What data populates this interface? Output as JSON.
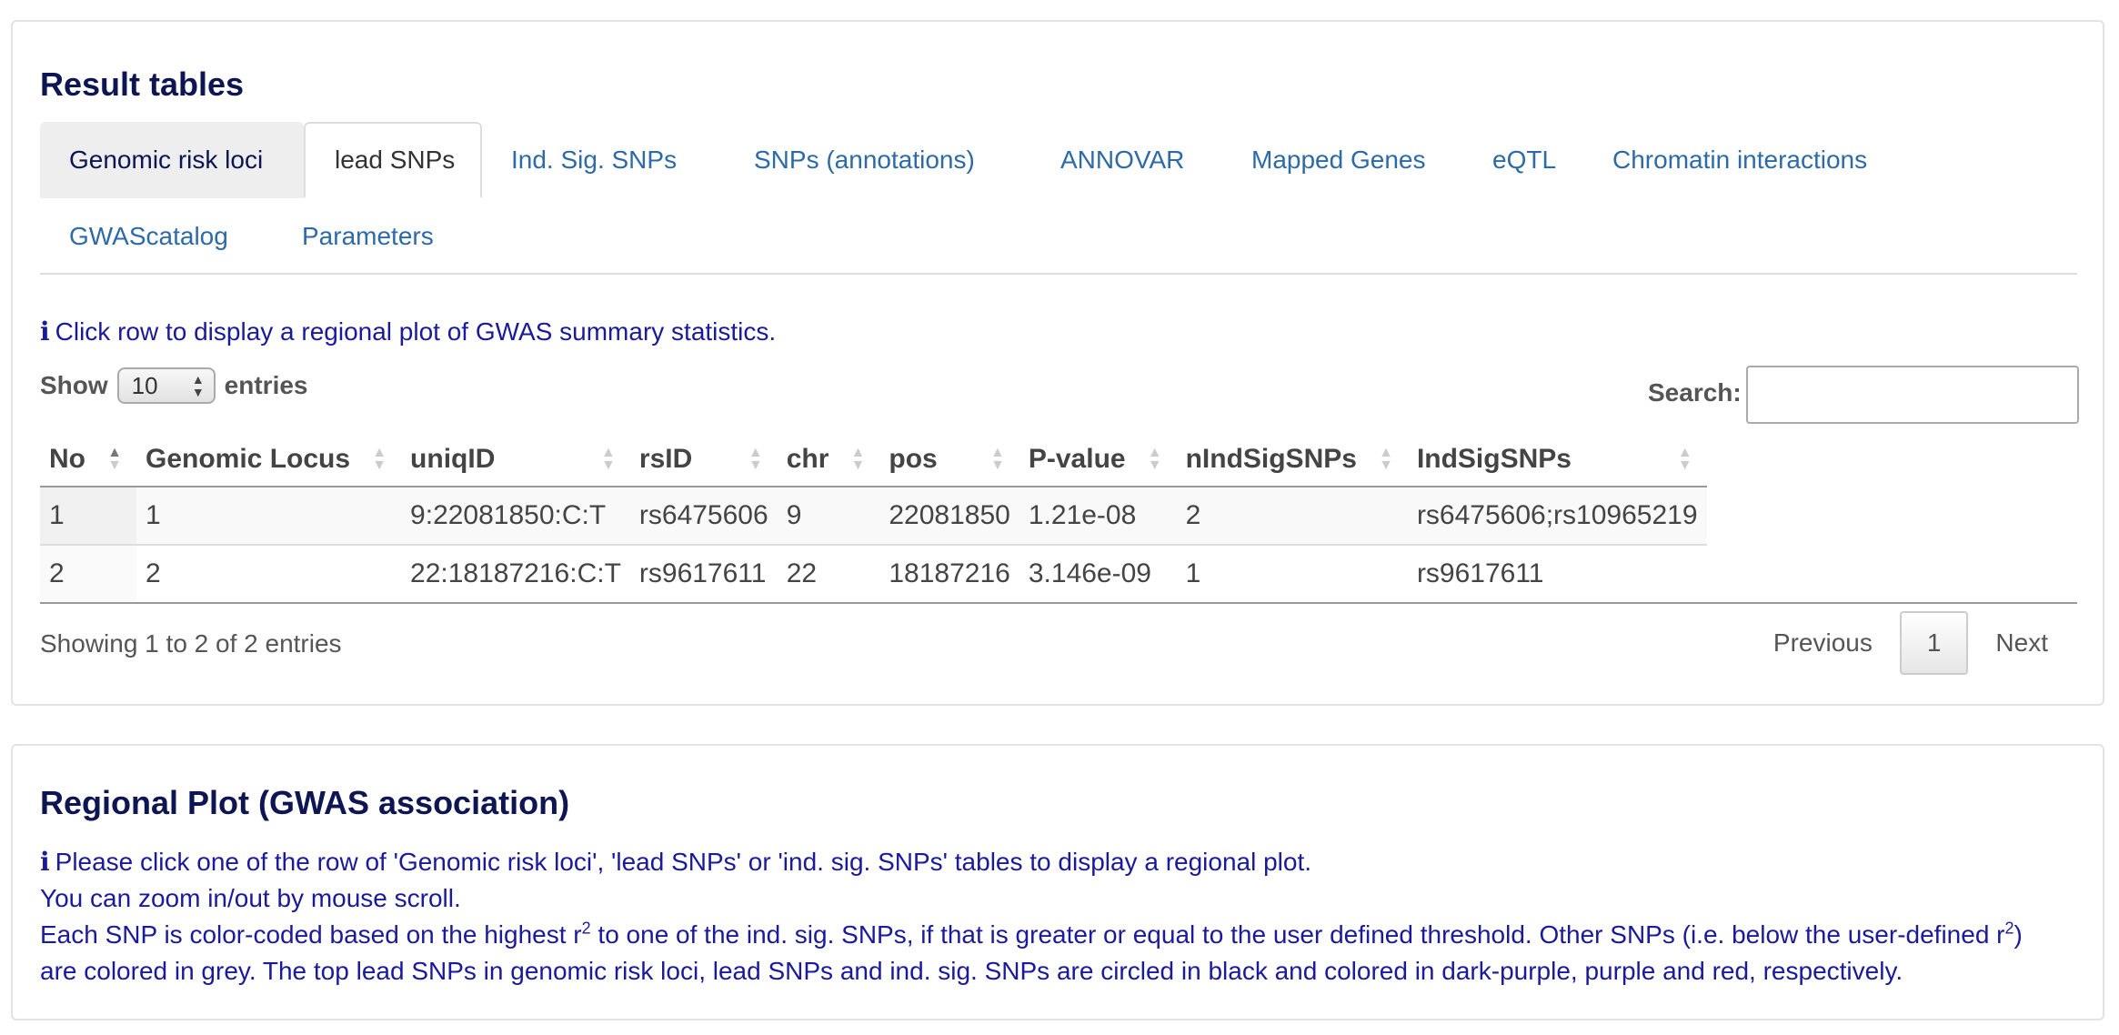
{
  "results": {
    "title": "Result tables",
    "tabs": [
      {
        "label": "Genomic risk loci",
        "state": "hover"
      },
      {
        "label": "lead SNPs",
        "state": "active"
      },
      {
        "label": "Ind. Sig. SNPs",
        "state": "normal"
      },
      {
        "label": "SNPs (annotations)",
        "state": "normal"
      },
      {
        "label": "ANNOVAR",
        "state": "normal"
      },
      {
        "label": "Mapped Genes",
        "state": "normal"
      },
      {
        "label": "eQTL",
        "state": "normal"
      },
      {
        "label": "Chromatin interactions",
        "state": "normal"
      },
      {
        "label": "GWAScatalog",
        "state": "normal"
      },
      {
        "label": "Parameters",
        "state": "normal"
      }
    ],
    "info_icon": "i",
    "info_text": "Click row to display a regional plot of GWAS summary statistics.",
    "show_label": "Show",
    "show_value": "10",
    "entries_label": "entries",
    "search_label": "Search:",
    "search_value": "",
    "columns": [
      "No",
      "Genomic Locus",
      "uniqID",
      "rsID",
      "chr",
      "pos",
      "P-value",
      "nIndSigSNPs",
      "IndSigSNPs"
    ],
    "sorted_column": "No",
    "rows": [
      [
        "1",
        "1",
        "9:22081850:C:T",
        "rs6475606",
        "9",
        "22081850",
        "1.21e-08",
        "2",
        "rs6475606;rs10965219"
      ],
      [
        "2",
        "2",
        "22:18187216:C:T",
        "rs9617611",
        "22",
        "18187216",
        "3.146e-09",
        "1",
        "rs9617611"
      ]
    ],
    "showing_text": "Showing 1 to 2 of 2 entries",
    "pagination": {
      "previous": "Previous",
      "page": "1",
      "next": "Next"
    }
  },
  "regional": {
    "title": "Regional Plot (GWAS association)",
    "info_icon": "i",
    "line1": "Please click one of the row of 'Genomic risk loci', 'lead SNPs' or 'ind. sig. SNPs' tables to display a regional plot.",
    "line2": "You can zoom in/out by mouse scroll.",
    "line3_a": "Each SNP is color-coded based on the highest r",
    "sup1": "2",
    "line3_b": " to one of the ind. sig. SNPs, if that is greater or equal to the user defined threshold. Other SNPs (i.e. below the user-defined r",
    "sup2": "2",
    "line3_c": ")",
    "line4": "are colored in grey. The top lead SNPs in genomic risk loci, lead SNPs and ind. sig. SNPs are circled in black and colored in dark-purple, purple and red, respectively."
  },
  "colors": {
    "title": "#0d1553",
    "link": "#2d6aa8",
    "info": "#1a1a9c"
  }
}
